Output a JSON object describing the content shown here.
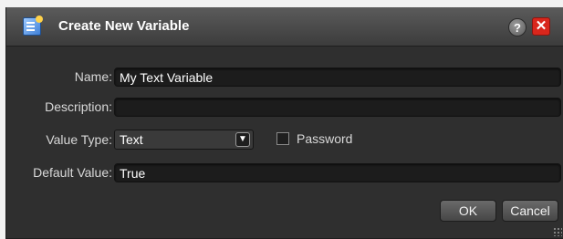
{
  "dialog": {
    "title": "Create New Variable",
    "help_label": "?",
    "close_label": "✕"
  },
  "form": {
    "name_label": "Name:",
    "name_value": "My Text Variable",
    "description_label": "Description:",
    "description_value": "",
    "value_type_label": "Value Type:",
    "value_type_selected": "Text",
    "password_label": "Password",
    "password_checked": false,
    "default_value_label": "Default Value:",
    "default_value": "True"
  },
  "buttons": {
    "ok": "OK",
    "cancel": "Cancel"
  },
  "icons": {
    "title": "variable-icon",
    "dropdown": "chevron-down-icon",
    "resize": "resize-grip-icon"
  },
  "colors": {
    "dialog_bg": "#2f2f2f",
    "close_red": "#d9261c",
    "field_bg": "#1c1c1c"
  }
}
